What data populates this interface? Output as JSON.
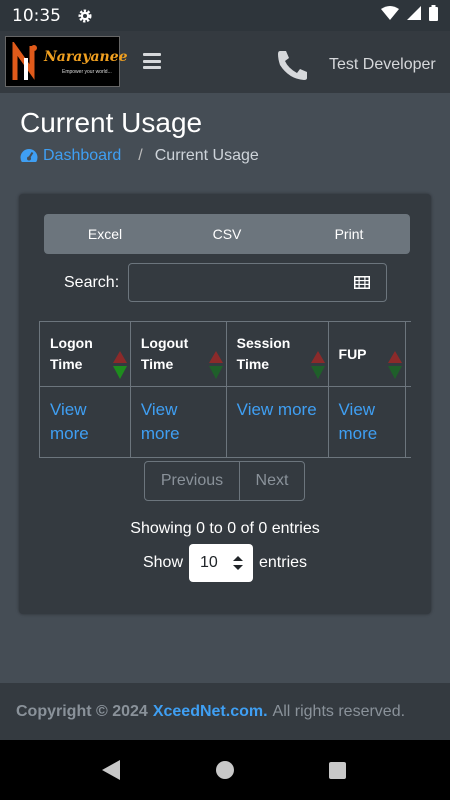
{
  "status_bar": {
    "time": "10:35",
    "icons": [
      "gear-icon",
      "wifi-icon",
      "signal-icon",
      "battery-icon"
    ]
  },
  "navbar": {
    "logo_text": "Narayanee",
    "logo_tagline": "Empower your world...",
    "menu_icon": "hamburger-icon",
    "phone_icon": "phone-icon",
    "user_name": "Test Developer"
  },
  "page": {
    "title": "Current Usage",
    "breadcrumb": {
      "home_label": "Dashboard",
      "home_icon": "tachometer-icon",
      "separator": "/",
      "current": "Current Usage"
    }
  },
  "table_tools": {
    "buttons": {
      "excel": "Excel",
      "csv": "CSV",
      "print": "Print"
    },
    "search_label": "Search:",
    "search_value": "",
    "search_icon": "grid-keyboard-icon"
  },
  "table": {
    "headers": [
      {
        "line1": "Logon",
        "line2": "Time"
      },
      {
        "line1": "Logout",
        "line2": "Time"
      },
      {
        "line1": "Session",
        "line2": "Time"
      },
      {
        "line1": "",
        "line2": "FUP"
      }
    ],
    "row": [
      "View more",
      "View more",
      "View more",
      "View more"
    ]
  },
  "pagination": {
    "previous": "Previous",
    "next": "Next"
  },
  "info": "Showing 0 to 0 of 0 entries",
  "length": {
    "show": "Show",
    "value": "10",
    "entries": "entries"
  },
  "footer": {
    "copyright": "Copyright © 2024",
    "brand": "XceedNet.com.",
    "rights": "All rights reserved."
  },
  "colors": {
    "background": "#454d55",
    "navbar": "#343a40",
    "link": "#3f9ff3",
    "button_group": "#6c757d"
  }
}
